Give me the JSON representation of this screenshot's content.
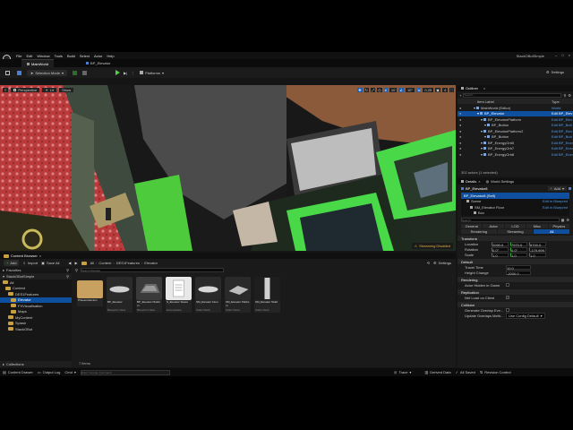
{
  "menu": [
    "File",
    "Edit",
    "Window",
    "Tools",
    "Build",
    "Select",
    "Actor",
    "Help"
  ],
  "app_title": "StackOBotSimple",
  "tabs": [
    "MainWorld",
    "BP_Elevator"
  ],
  "toolbar": {
    "selection_mode": "Selection Mode",
    "platforms": "Platforms",
    "settings": "Settings"
  },
  "viewport": {
    "perspective": "Perspective",
    "lit": "Lit",
    "show": "Show",
    "snap_move": "10",
    "snap_rotate": "10°",
    "snap_scale": "0.25",
    "camera_speed": "4",
    "streaming": "Streaming Disabled"
  },
  "content_browser": {
    "tab_label": "Content Browser",
    "add": "Add",
    "import": "Import",
    "save_all": "Save All",
    "breadcrumbs": [
      "All",
      "Content",
      "DES1Features",
      "Elevator"
    ],
    "settings": "Settings",
    "favorites": "Favorites",
    "project_root": "StackOBotSimple",
    "search_placeholder": "Search Elevator",
    "tree": [
      "All",
      "Content",
      "DES1Features",
      "Elevator",
      "FXVisualisation",
      "Maps",
      "MyContent",
      "Splash",
      "StackOBot"
    ],
    "assets": [
      {
        "name": "PhaseCollection",
        "type": ""
      },
      {
        "name": "BP_Elevator",
        "type": "Blueprint Class"
      },
      {
        "name": "BP_Elevator Platform",
        "type": "Blueprint Class"
      },
      {
        "name": "S_Elevator States",
        "type": "Enumeration"
      },
      {
        "name": "SM_Elevator Floor",
        "type": "Static Mesh"
      },
      {
        "name": "SM_Elevator Platform",
        "type": "Static Mesh"
      },
      {
        "name": "SM_Elevator Shaft",
        "type": "Static Mesh"
      }
    ],
    "items_count": "7 items",
    "collections": "Collections"
  },
  "outliner": {
    "title": "Outliner",
    "search_placeholder": "Search...",
    "col_label": "Item Label",
    "col_type": "Type",
    "rows": [
      {
        "label": "MainWorld (Editor)",
        "type": "World",
        "indent": 0,
        "selected": false
      },
      {
        "label": "BP_Elevator",
        "type": "Edit BP_Elev",
        "indent": 1,
        "selected": true
      },
      {
        "label": "BP_ElevatorPlatform",
        "type": "Edit BP_Elev",
        "indent": 2,
        "selected": false
      },
      {
        "label": "BP_Button",
        "type": "Edit BP_Butt",
        "indent": 3,
        "selected": false
      },
      {
        "label": "BP_ElevatorPlatform2",
        "type": "Edit BP_Elev",
        "indent": 2,
        "selected": false
      },
      {
        "label": "BP_Button",
        "type": "Edit BP_Butt",
        "indent": 3,
        "selected": false
      },
      {
        "label": "BP_EnergyOrb5",
        "type": "Edit BP_Ener",
        "indent": 2,
        "selected": false
      },
      {
        "label": "BP_EnergyOrb7",
        "type": "Edit BP_Ener",
        "indent": 2,
        "selected": false
      },
      {
        "label": "BP_EnergyOrb8",
        "type": "Edit BP_Ener",
        "indent": 2,
        "selected": false
      }
    ],
    "count": "302 actors (1 selected)"
  },
  "details": {
    "tab": "Details",
    "tab2": "World Settings",
    "object_name": "BP_Elevator8",
    "add": "Add",
    "component_self": "BP_Elevator8 (Self)",
    "components": [
      {
        "name": "Scene",
        "link": "Edit in Blueprint"
      },
      {
        "name": "SM_Elevator Floor",
        "link": "Edit in Blueprint"
      },
      {
        "name": "Box",
        "link": ""
      }
    ],
    "search_placeholder": "Search",
    "filters": [
      "General",
      "Actor",
      "LOD",
      "Misc",
      "Physics"
    ],
    "filters2": [
      "Rendering",
      "Streaming",
      "All"
    ],
    "transform": "Transform",
    "location_label": "Location",
    "location": [
      "2090.0",
      "7970.0",
      "6700.0"
    ],
    "rotation_label": "Rotation",
    "rotation": [
      "0.0°",
      "0.0°",
      "-179.999"
    ],
    "scale_label": "Scale",
    "scale": [
      "1.0",
      "1.0",
      "1.0"
    ],
    "default": "Default",
    "travel_time_label": "Travel Time",
    "travel_time": "10.0",
    "height_change_label": "Height Change",
    "height_change": "-2000.0",
    "rendering": "Rendering",
    "actor_hidden": "Actor Hidden in Game",
    "replication": "Replication",
    "net_load": "Net Load on Client",
    "collision": "Collision",
    "gen_overlap": "Generate Overlap Eve...",
    "update_overlaps": "Update Overlaps Meth...",
    "update_overlaps_value": "Use Config Default"
  },
  "statusbar": {
    "content_drawer": "Content Drawer",
    "output_log": "Output Log",
    "cmd": "Cmd",
    "console_placeholder": "Enter Console Command",
    "trace": "Trace",
    "derived_data": "Derived Data",
    "all_saved": "All Saved",
    "revision_control": "Revision Control"
  }
}
